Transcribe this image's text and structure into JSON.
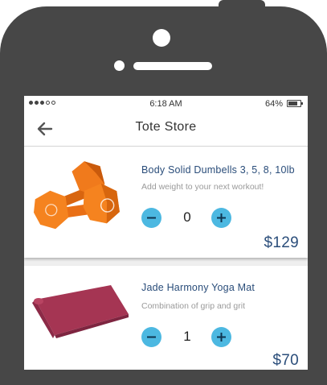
{
  "status_bar": {
    "time": "6:18 AM",
    "battery": "64%"
  },
  "header": {
    "title": "Tote Store"
  },
  "products": [
    {
      "name": "Body Solid Dumbells 3, 5, 8, 10lb",
      "description": "Add weight to your next workout!",
      "quantity": "0",
      "price": "$129"
    },
    {
      "name": "Jade Harmony Yoga Mat",
      "description": "Combination of grip and grit",
      "quantity": "1",
      "price": "$70"
    }
  ],
  "colors": {
    "accent": "#4cb8e1",
    "product_title": "#2a4d7a",
    "dumbbell": "#f07a1c",
    "yoga_mat": "#a53553",
    "device": "#474747"
  },
  "icons": [
    "back-arrow-icon",
    "minus-icon",
    "plus-icon",
    "battery-icon",
    "signal-dots-icon"
  ]
}
